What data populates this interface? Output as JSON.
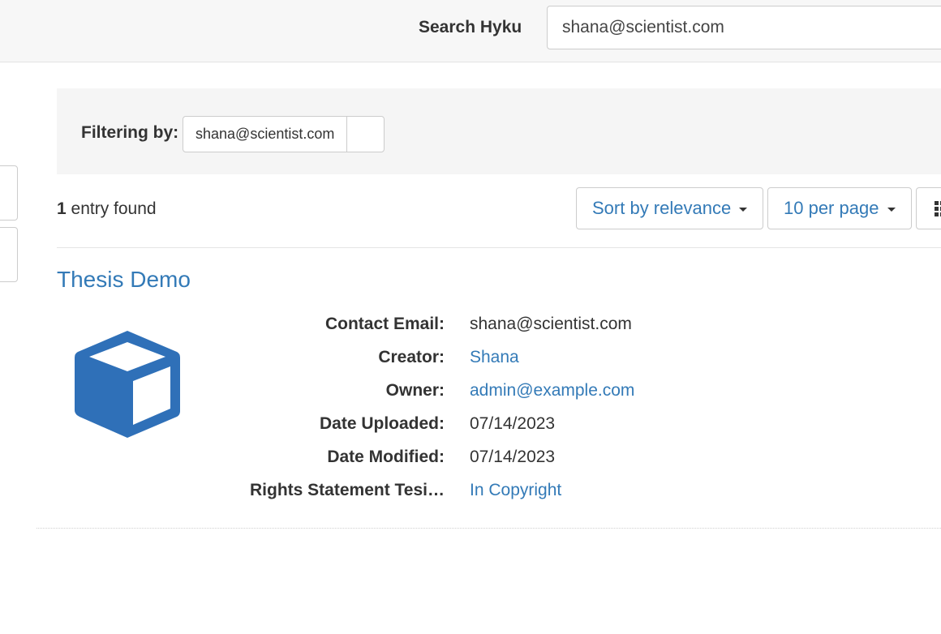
{
  "search": {
    "label": "Search Hyku",
    "value": "shana@scientist.com"
  },
  "constraints": {
    "label": "Filtering by:",
    "filter_value": "shana@scientist.com"
  },
  "results": {
    "count": "1",
    "count_suffix": " entry found",
    "sort_label": "Sort by relevance",
    "per_page_label": "10 per page"
  },
  "item": {
    "title": "Thesis Demo",
    "icon": "cube-icon",
    "icon_color": "#2f70b8",
    "fields": {
      "contact_email": {
        "label": "Contact Email:",
        "value": "shana@scientist.com"
      },
      "creator": {
        "label": "Creator:",
        "value": "Shana"
      },
      "owner": {
        "label": "Owner:",
        "value": "admin@example.com"
      },
      "date_uploaded": {
        "label": "Date Uploaded:",
        "value": "07/14/2023"
      },
      "date_modified": {
        "label": "Date Modified:",
        "value": "07/14/2023"
      },
      "rights_statement": {
        "label": "Rights Statement Tesi…",
        "value": "In Copyright"
      }
    }
  },
  "colors": {
    "link": "#337ab7",
    "panel_bg": "#f5f5f5",
    "header_bg": "#f7f7f7"
  }
}
